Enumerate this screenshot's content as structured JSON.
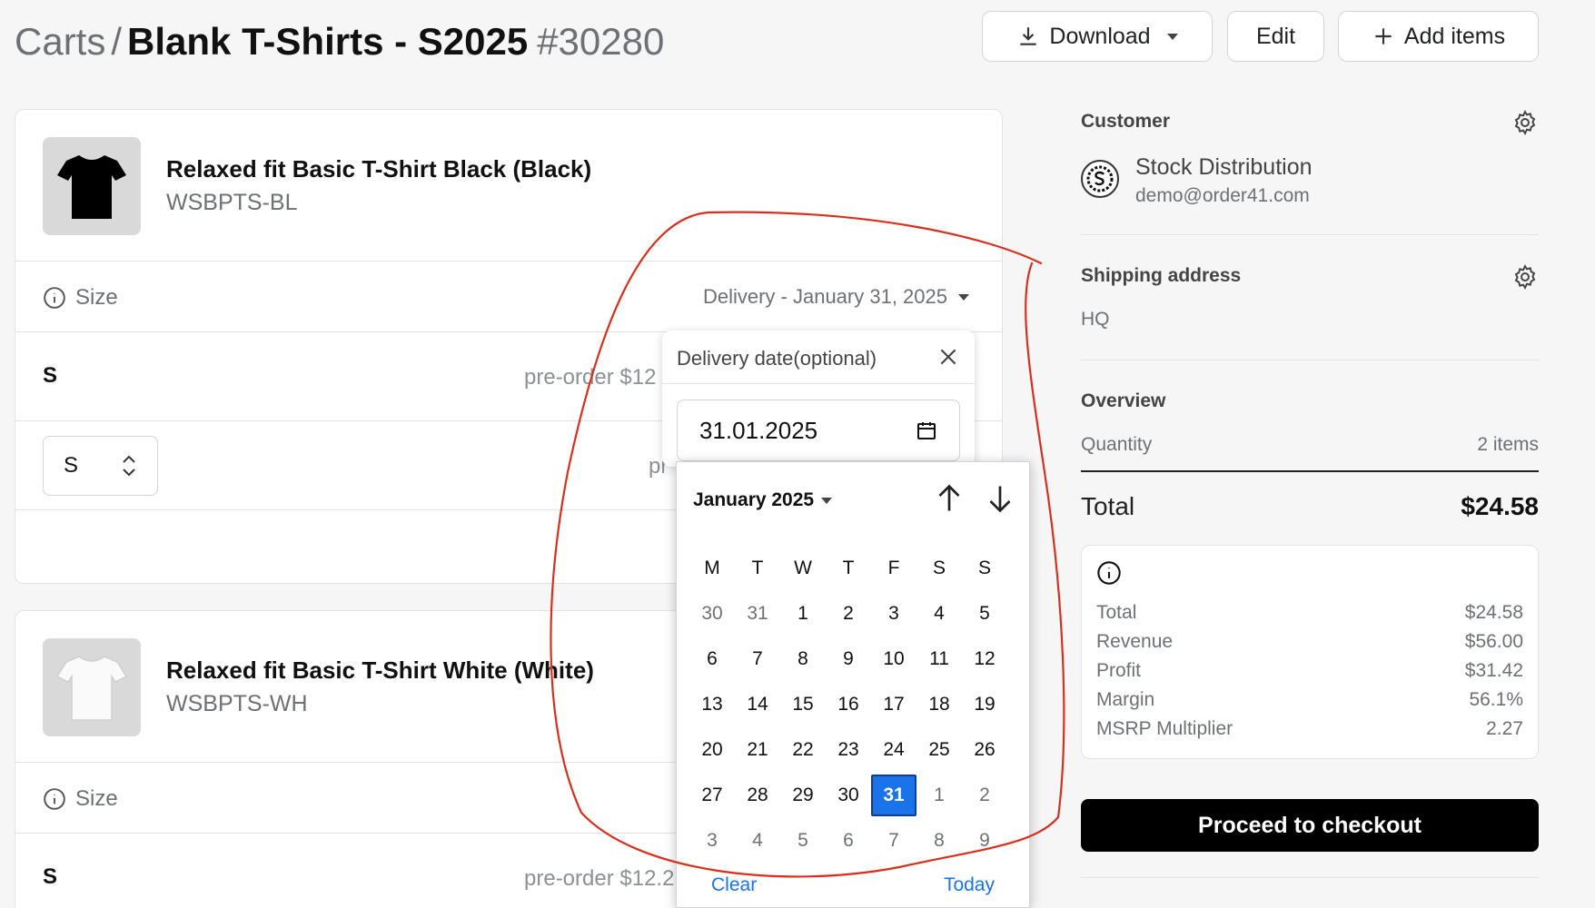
{
  "header": {
    "breadcrumb_root": "Carts",
    "separator": "/",
    "title": "Blank T-Shirts - S2025",
    "cart_id": "#30280",
    "buttons": {
      "download": "Download",
      "edit": "Edit",
      "add_items": "Add items"
    }
  },
  "products": [
    {
      "name": "Relaxed fit Basic T-Shirt Black (Black)",
      "sku": "WSBPTS-BL",
      "color": "#000000",
      "size_label": "Size",
      "delivery": "Delivery - January 31, 2025",
      "size_value": "S",
      "preorder": "pre-order $12",
      "select_value": "S",
      "preorder_2": "pr"
    },
    {
      "name": "Relaxed fit Basic T-Shirt White (White)",
      "sku": "WSBPTS-WH",
      "color": "#ffffff",
      "size_label": "Size",
      "size_value": "S",
      "preorder": "pre-order $12.2"
    }
  ],
  "date_popover": {
    "title": "Delivery date(optional)",
    "value": "31.01.2025"
  },
  "calendar": {
    "month_label": "January 2025",
    "weekdays": [
      "M",
      "T",
      "W",
      "T",
      "F",
      "S",
      "S"
    ],
    "weeks": [
      [
        "30",
        "31",
        "1",
        "2",
        "3",
        "4",
        "5"
      ],
      [
        "6",
        "7",
        "8",
        "9",
        "10",
        "11",
        "12"
      ],
      [
        "13",
        "14",
        "15",
        "16",
        "17",
        "18",
        "19"
      ],
      [
        "20",
        "21",
        "22",
        "23",
        "24",
        "25",
        "26"
      ],
      [
        "27",
        "28",
        "29",
        "30",
        "31",
        "1",
        "2"
      ],
      [
        "3",
        "4",
        "5",
        "6",
        "7",
        "8",
        "9"
      ]
    ],
    "selected": "31",
    "clear_label": "Clear",
    "today_label": "Today",
    "accent": "#1a73e8"
  },
  "sidebar": {
    "customer": {
      "title": "Customer",
      "name": "Stock Distribution",
      "email": "demo@order41.com"
    },
    "shipping": {
      "title": "Shipping address",
      "address": "HQ"
    },
    "overview": {
      "title": "Overview",
      "quantity_label": "Quantity",
      "quantity_value": "2 items",
      "total_label": "Total",
      "total_value": "$24.58"
    },
    "summary": [
      {
        "label": "Total",
        "value": "$24.58"
      },
      {
        "label": "Revenue",
        "value": "$56.00"
      },
      {
        "label": "Profit",
        "value": "$31.42"
      },
      {
        "label": "Margin",
        "value": "56.1%"
      },
      {
        "label": "MSRP Multiplier",
        "value": "2.27"
      }
    ],
    "checkout_label": "Proceed to checkout"
  },
  "colors": {
    "annotation": "#d9301e",
    "primary_button": "#000000"
  }
}
